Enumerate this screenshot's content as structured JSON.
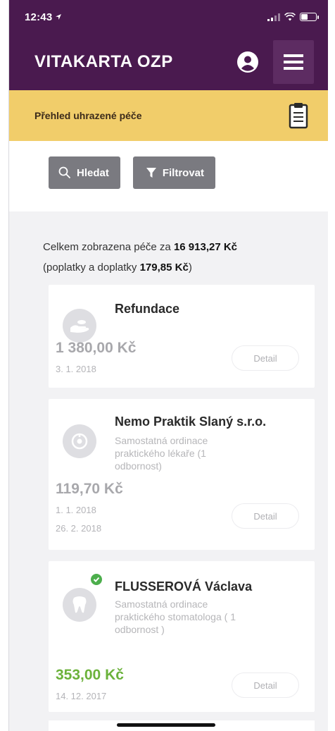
{
  "status_bar": {
    "time": "12:43",
    "location_arrow": "location-arrow-icon"
  },
  "header": {
    "title": "VITAKARTA OZP",
    "profile_icon": "user-circle-icon",
    "menu_icon": "hamburger-menu-icon"
  },
  "subheader": {
    "title": "Přehled uhrazené péče",
    "icon": "clipboard-icon"
  },
  "actions": {
    "search_label": "Hledat",
    "filter_label": "Filtrovat"
  },
  "summary": {
    "line1_prefix": "Celkem zobrazena péče za ",
    "total": "16 913,27 Kč",
    "line2_prefix": "(poplatky a doplatky ",
    "fees": "179,85 Kč",
    "line2_suffix": ")"
  },
  "items": [
    {
      "name": "Refundace",
      "desc": "",
      "amount": "1 380,00 Kč",
      "dates": [
        "3. 1. 2018"
      ],
      "detail": "Detail",
      "icon": "refund-hand-icon",
      "paid": false
    },
    {
      "name": "Nemo Praktik Slaný s.r.o.",
      "desc": "Samostatná ordinace praktického lékaře (1 odbornost)",
      "amount": "119,70 Kč",
      "dates": [
        "1. 1. 2018",
        "26. 2. 2018"
      ],
      "detail": "Detail",
      "icon": "stethoscope-icon",
      "paid": false
    },
    {
      "name": "FLUSSEROVÁ Václava",
      "desc": "Samostatná ordinace praktického stomatologa ( 1 odbornost )",
      "amount": "353,00 Kč",
      "dates": [
        "14. 12. 2017"
      ],
      "detail": "Detail",
      "icon": "tooth-icon",
      "paid": true
    }
  ],
  "colors": {
    "header": "#4a1a4f",
    "subheader": "#f1cd6a",
    "button": "#7a7a80",
    "paid_green": "#6bb23b"
  }
}
